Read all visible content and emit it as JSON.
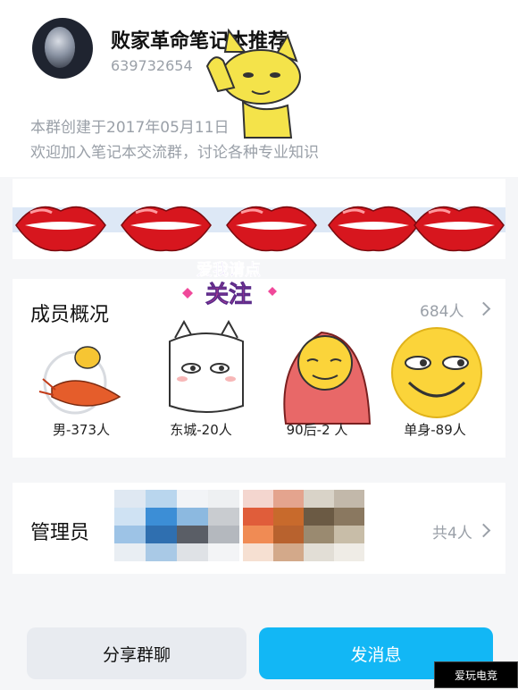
{
  "header": {
    "group_name": "败家革命笔记本推荐",
    "group_id": "639732654",
    "created_text": "本群创建于2017年05月11日",
    "welcome_text": "欢迎加入笔记本交流群，讨论各种专业知识"
  },
  "sticker": {
    "line1": "爱我请点",
    "line2": "关注"
  },
  "members": {
    "title": "成员概况",
    "count": "684人",
    "items": [
      {
        "label": "男-373人"
      },
      {
        "label": "东城-20人"
      },
      {
        "label": "90后-2 人"
      },
      {
        "label": "单身-89人"
      }
    ]
  },
  "admins": {
    "title": "管理员",
    "count": "共4人"
  },
  "actions": {
    "share": "分享群聊",
    "send": "发消息"
  },
  "watermark": "爱玩电竞",
  "colors": {
    "accent": "#12b7f5",
    "lips": "#d7161e",
    "gray_text": "#9aa0a8"
  }
}
